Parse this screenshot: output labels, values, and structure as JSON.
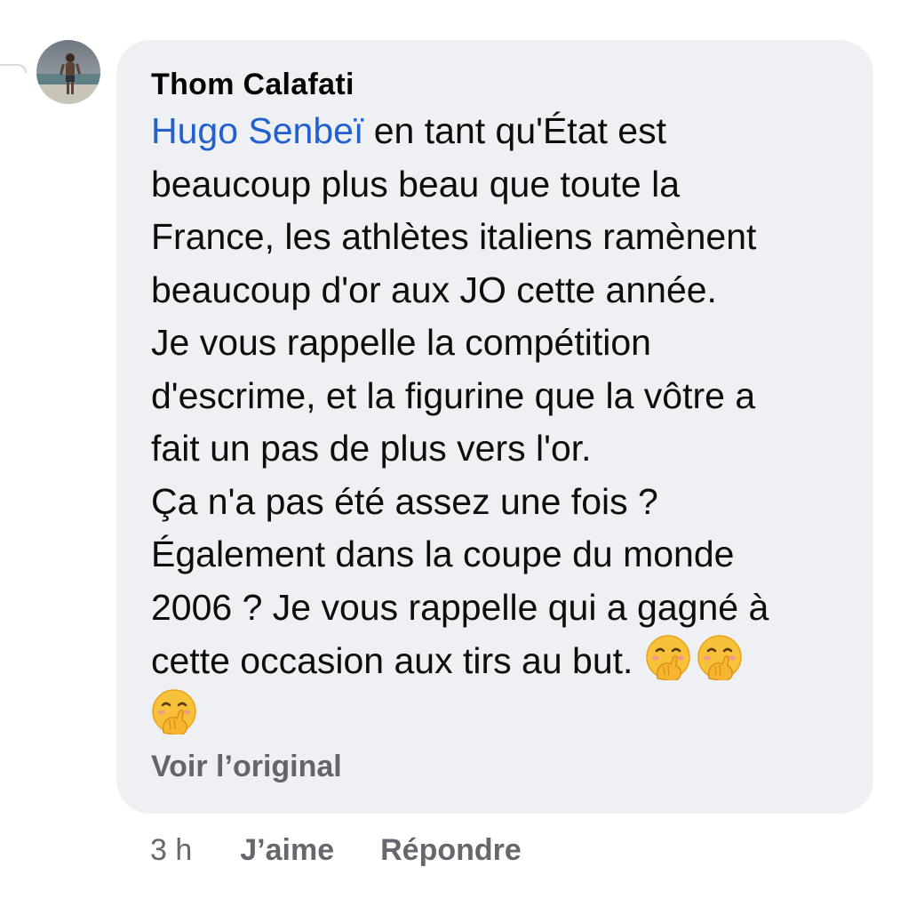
{
  "comment": {
    "author": "Thom Calafati",
    "mention": "Hugo Senbeï",
    "lines": [
      " en tant qu'État est",
      "beaucoup plus beau que toute la",
      "France, les athlètes italiens ramènent",
      "beaucoup d'or aux JO cette année.",
      "Je vous rappelle la compétition",
      "d'escrime, et la figurine que la vôtre a",
      "fait un pas de plus vers l'or.",
      "Ça n'a pas été assez une fois ?",
      "Également dans la coupe du monde",
      "2006 ? Je vous rappelle qui a gagné à",
      "cette occasion aux tirs au but."
    ],
    "emoji_icon": "face-with-hand-over-mouth-emoji",
    "see_original_label": "Voir l’original"
  },
  "actions": {
    "timestamp": "3 h",
    "like_label": "J’aime",
    "reply_label": "Répondre"
  },
  "colors": {
    "bubble_bg": "#eff0f4",
    "mention": "#2360cf",
    "secondary_text": "#65686d"
  }
}
